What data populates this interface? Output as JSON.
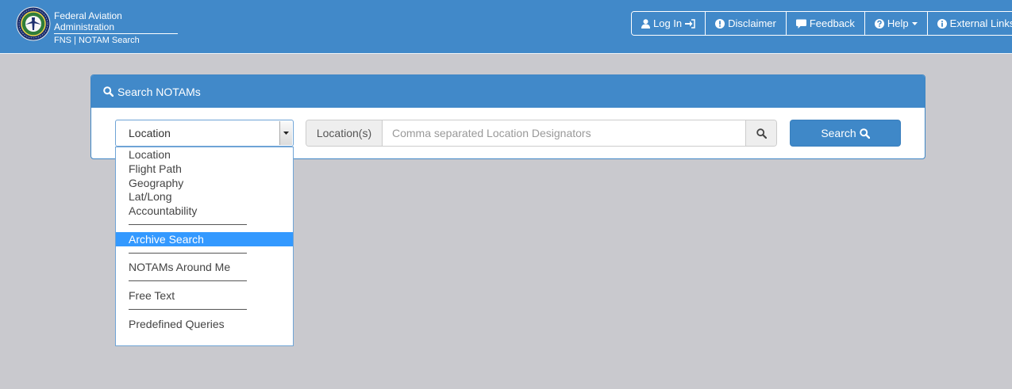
{
  "header": {
    "brand_title": "Federal Aviation Administration",
    "brand_subtitle": "FNS | NOTAM Search",
    "nav": {
      "login": "Log In",
      "disclaimer": "Disclaimer",
      "feedback": "Feedback",
      "help": "Help",
      "external_links": "External Links"
    }
  },
  "panel": {
    "title": "Search NOTAMs"
  },
  "search": {
    "type_selected": "Location",
    "addon_label": "Location(s)",
    "placeholder": "Comma separated Location Designators",
    "value": "",
    "button_label": "Search"
  },
  "dropdown": {
    "options": [
      "Location",
      "Flight Path",
      "Geography",
      "Lat/Long",
      "Accountability",
      "Archive Search",
      "NOTAMs Around Me",
      "Free Text",
      "Predefined Queries"
    ],
    "highlighted": "Archive Search"
  },
  "colors": {
    "brand_blue": "#4189c9",
    "page_background": "#c9c9ce",
    "highlight": "#3399ff"
  },
  "icons": {
    "login": "user-icon",
    "disclaimer": "exclamation-circle-icon",
    "feedback": "comment-icon",
    "help": "question-circle-icon",
    "external_links": "info-circle-icon",
    "search": "search-icon"
  }
}
